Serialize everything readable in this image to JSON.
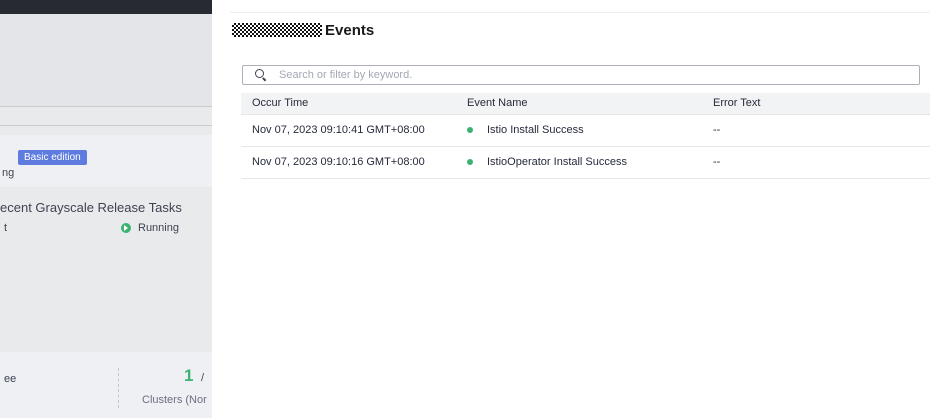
{
  "background": {
    "badge": "Basic edition",
    "status_fragment": "ng",
    "section_title": "ecent Grayscale Release Tasks",
    "task_fragment": "t",
    "task_status": "Running",
    "bottom_fragment": "ee",
    "count": "1",
    "slash": "/",
    "count_label": "Clusters (Nor"
  },
  "drawer": {
    "title": "Events",
    "search": {
      "placeholder": "Search or filter by keyword.",
      "value": ""
    },
    "table": {
      "columns": [
        "Occur Time",
        "Event Name",
        "Error Text"
      ],
      "rows": [
        {
          "time": "Nov 07, 2023 09:10:41 GMT+08:00",
          "event": "Istio Install Success",
          "error": "--"
        },
        {
          "time": "Nov 07, 2023 09:10:16 GMT+08:00",
          "event": "IstioOperator Install Success",
          "error": "--"
        }
      ]
    }
  },
  "colors": {
    "success": "#3cb371",
    "badge": "#5e7ce0",
    "topbar": "#272a31"
  },
  "icons": {
    "search": "search-icon",
    "running": "play-circle-icon",
    "status": "status-dot-icon"
  }
}
